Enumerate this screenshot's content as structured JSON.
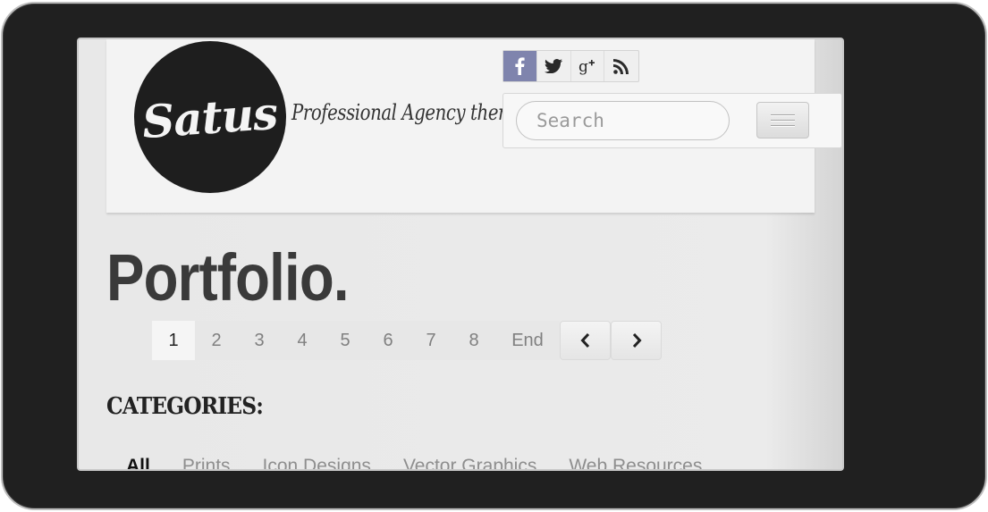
{
  "brand": {
    "logo_text": "Satus",
    "tagline": "Professional Agency theme"
  },
  "social": [
    {
      "name": "facebook",
      "glyph": "f"
    },
    {
      "name": "twitter"
    },
    {
      "name": "google-plus",
      "glyph": "g⁺"
    },
    {
      "name": "rss"
    }
  ],
  "search": {
    "placeholder": "Search"
  },
  "page": {
    "title": "Portfolio."
  },
  "pagination": {
    "pages": [
      "1",
      "2",
      "3",
      "4",
      "5",
      "6",
      "7",
      "8"
    ],
    "active": "1",
    "end_label": "End"
  },
  "categories": {
    "heading": "CATEGORIES:",
    "filters": [
      "All",
      "Prints",
      "Icon Designs",
      "Vector Graphics",
      "Web Resources"
    ],
    "active": "All"
  },
  "colors": {
    "frame": "#202020",
    "facebook_active": "#7f84ad",
    "logo_bg": "#1e1e1e"
  }
}
